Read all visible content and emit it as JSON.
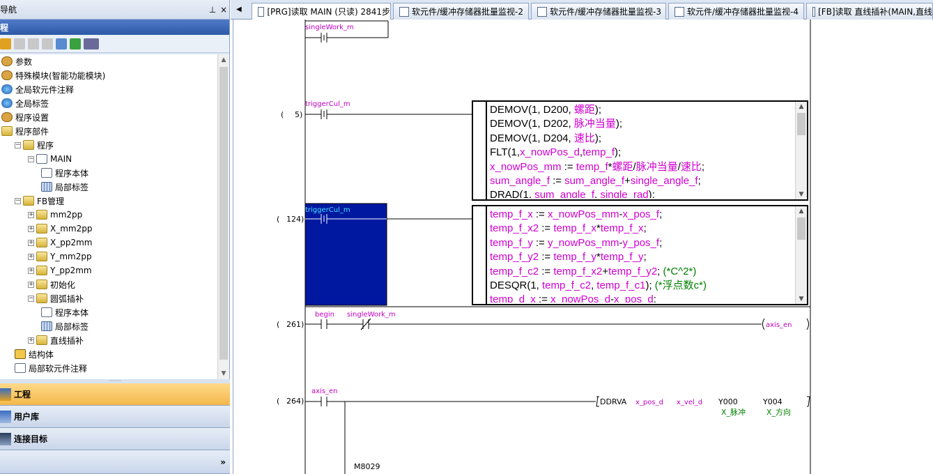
{
  "nav": {
    "title": "导航",
    "pin": "ᵖ",
    "close": "×",
    "project_header": "程",
    "tree": [
      {
        "label": "参数",
        "indent": 0,
        "expander": "",
        "icon": "gear"
      },
      {
        "label": "特殊模块(智能功能模块)",
        "indent": 0,
        "expander": "",
        "icon": "gear"
      },
      {
        "label": "全局软元件注释",
        "indent": 0,
        "expander": "",
        "icon": "globe"
      },
      {
        "label": "全局标签",
        "indent": 0,
        "expander": "",
        "icon": "globe"
      },
      {
        "label": "程序设置",
        "indent": 0,
        "expander": "",
        "icon": "gear"
      },
      {
        "label": "程序部件",
        "indent": 0,
        "expander": "",
        "icon": "folder"
      },
      {
        "label": "程序",
        "indent": 1,
        "expander": "⊟",
        "icon": "folder"
      },
      {
        "label": "MAIN",
        "indent": 2,
        "expander": "⊟",
        "icon": "doc"
      },
      {
        "label": "程序本体",
        "indent": 3,
        "expander": "",
        "icon": "doc"
      },
      {
        "label": "局部标签",
        "indent": 3,
        "expander": "",
        "icon": "grid"
      },
      {
        "label": "FB管理",
        "indent": 1,
        "expander": "⊟",
        "icon": "folder"
      },
      {
        "label": "mm2pp",
        "indent": 2,
        "expander": "⊞",
        "icon": "folder"
      },
      {
        "label": "X_mm2pp",
        "indent": 2,
        "expander": "⊞",
        "icon": "folder"
      },
      {
        "label": "X_pp2mm",
        "indent": 2,
        "expander": "⊞",
        "icon": "folder"
      },
      {
        "label": "Y_mm2pp",
        "indent": 2,
        "expander": "⊞",
        "icon": "folder"
      },
      {
        "label": "Y_pp2mm",
        "indent": 2,
        "expander": "⊞",
        "icon": "folder"
      },
      {
        "label": "初始化",
        "indent": 2,
        "expander": "⊞",
        "icon": "folder"
      },
      {
        "label": "圆弧插补",
        "indent": 2,
        "expander": "⊟",
        "icon": "folder"
      },
      {
        "label": "程序本体",
        "indent": 3,
        "expander": "",
        "icon": "doc"
      },
      {
        "label": "局部标签",
        "indent": 3,
        "expander": "",
        "icon": "grid"
      },
      {
        "label": "直线插补",
        "indent": 2,
        "expander": "⊞",
        "icon": "folder"
      },
      {
        "label": "结构体",
        "indent": 1,
        "expander": "",
        "icon": "struct"
      },
      {
        "label": "局部软元件注释",
        "indent": 1,
        "expander": "",
        "icon": "doc"
      }
    ],
    "panels": {
      "project": "工程",
      "user_lib": "用户库",
      "connection": "连接目标",
      "more": "»"
    }
  },
  "tabs": [
    {
      "label": "[PRG]读取 MAIN (只读) 2841步",
      "active": true
    },
    {
      "label": "软元件/缓冲存储器批量监视-2",
      "active": false
    },
    {
      "label": "软元件/缓冲存储器批量监视-3",
      "active": false
    },
    {
      "label": "软元件/缓冲存储器批量监视-4",
      "active": false
    },
    {
      "label": "[FB]读取 直线插补(MAIN,直线",
      "active": false
    }
  ],
  "ladder": {
    "rung0": {
      "device": "singleWork_m"
    },
    "rung5": {
      "step": "5)",
      "open": "(",
      "device": "triggerCul_m"
    },
    "rung124": {
      "step": "124)",
      "open": "(",
      "device": "triggerCul_m"
    },
    "rung261": {
      "step": "261)",
      "open": "(",
      "dev1": "begin",
      "dev2": "singleWork_m",
      "coil": "axis_en"
    },
    "rung264": {
      "step": "264)",
      "open": "(",
      "dev1": "axis_en",
      "instr": "DDRVA",
      "op1": "x_pos_d",
      "op2": "x_vel_d",
      "op3": "Y000",
      "op4": "Y004",
      "c3": "X_脉冲",
      "c4": "X_方向",
      "m8029": "M8029"
    }
  },
  "st_box1": [
    [
      [
        "k",
        "DEMOV(1, D200, "
      ],
      [
        "m",
        "螺距"
      ],
      [
        "k",
        ");"
      ]
    ],
    [
      [
        "k",
        "DEMOV(1, D202, "
      ],
      [
        "m",
        "脉冲当量"
      ],
      [
        "k",
        ");"
      ]
    ],
    [
      [
        "k",
        "DEMOV(1, D204, "
      ],
      [
        "m",
        "速比"
      ],
      [
        "k",
        ");"
      ]
    ],
    [
      [
        "k",
        "FLT(1,"
      ],
      [
        "m",
        "x_nowPos_d"
      ],
      [
        "k",
        ","
      ],
      [
        "m",
        "temp_f"
      ],
      [
        "k",
        ");"
      ]
    ],
    [
      [
        "m",
        "x_nowPos_mm"
      ],
      [
        "k",
        " := "
      ],
      [
        "m",
        "temp_f"
      ],
      [
        "k",
        "*"
      ],
      [
        "m",
        "螺距"
      ],
      [
        "k",
        "/"
      ],
      [
        "m",
        "脉冲当量"
      ],
      [
        "k",
        "/"
      ],
      [
        "m",
        "速比"
      ],
      [
        "k",
        ";"
      ]
    ],
    [
      [
        "m",
        "sum_angle_f"
      ],
      [
        "k",
        " := "
      ],
      [
        "m",
        "sum_angle_f"
      ],
      [
        "k",
        "+"
      ],
      [
        "m",
        "single_angle_f"
      ],
      [
        "k",
        ";"
      ]
    ],
    [
      [
        "k",
        "DRAD(1, "
      ],
      [
        "m",
        "sum_angle_f"
      ],
      [
        "k",
        ", "
      ],
      [
        "m",
        "single_rad"
      ],
      [
        "k",
        ");"
      ]
    ]
  ],
  "st_box2": [
    [
      [
        "m",
        "temp_f_x"
      ],
      [
        "k",
        " := "
      ],
      [
        "m",
        "x_nowPos_mm"
      ],
      [
        "k",
        "-"
      ],
      [
        "m",
        "x_pos_f"
      ],
      [
        "k",
        ";"
      ]
    ],
    [
      [
        "m",
        "temp_f_x2"
      ],
      [
        "k",
        " := "
      ],
      [
        "m",
        "temp_f_x"
      ],
      [
        "k",
        "*"
      ],
      [
        "m",
        "temp_f_x"
      ],
      [
        "k",
        ";"
      ]
    ],
    [
      [
        "m",
        "temp_f_y"
      ],
      [
        "k",
        " := "
      ],
      [
        "m",
        "y_nowPos_mm"
      ],
      [
        "k",
        "-"
      ],
      [
        "m",
        "y_pos_f"
      ],
      [
        "k",
        ";"
      ]
    ],
    [
      [
        "m",
        "temp_f_y2"
      ],
      [
        "k",
        " := "
      ],
      [
        "m",
        "temp_f_y"
      ],
      [
        "k",
        "*"
      ],
      [
        "m",
        "temp_f_y"
      ],
      [
        "k",
        ";"
      ]
    ],
    [
      [
        "m",
        "temp_f_c2"
      ],
      [
        "k",
        " := "
      ],
      [
        "m",
        "temp_f_x2"
      ],
      [
        "k",
        "+"
      ],
      [
        "m",
        "temp_f_y2"
      ],
      [
        "k",
        ";  "
      ],
      [
        "g",
        "(*C^2*)"
      ]
    ],
    [
      [
        "k",
        "DESQR(1, "
      ],
      [
        "m",
        "temp_f_c2"
      ],
      [
        "k",
        ", "
      ],
      [
        "m",
        "temp_f_c1"
      ],
      [
        "k",
        "); "
      ],
      [
        "g",
        "(*浮点数c*)"
      ]
    ],
    [
      [
        "m",
        "temp_d_x"
      ],
      [
        "k",
        " := "
      ],
      [
        "m",
        "x_nowPos_d"
      ],
      [
        "k",
        "-"
      ],
      [
        "m",
        "x_pos_d"
      ],
      [
        "k",
        ";"
      ]
    ]
  ]
}
